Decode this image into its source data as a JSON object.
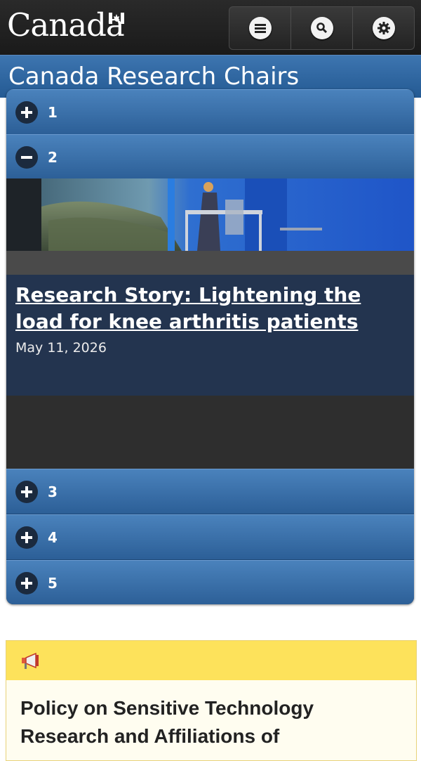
{
  "header": {
    "wordmark": "Canada",
    "buttons": [
      {
        "name": "menu",
        "icon": "menu-icon"
      },
      {
        "name": "search",
        "icon": "search-icon"
      },
      {
        "name": "settings",
        "icon": "gear-icon"
      }
    ]
  },
  "site_title": "Canada Research Chairs",
  "accordion": {
    "items": [
      {
        "label": "1",
        "state": "collapsed"
      },
      {
        "label": "2",
        "state": "expanded"
      },
      {
        "label": "3",
        "state": "collapsed"
      },
      {
        "label": "4",
        "state": "collapsed"
      },
      {
        "label": "5",
        "state": "collapsed"
      }
    ],
    "expanded_panel": {
      "story_title": "Research Story: Lightening the load for knee arthritis patients",
      "date": "May 11, 2026"
    }
  },
  "notice": {
    "icon": "megaphone-icon",
    "title": "Policy on Sensitive Technology Research and Affiliations of"
  },
  "colors": {
    "header_bg": "#1a1a1a",
    "accent_blue": "#2c5f97",
    "story_bg": "#23344f",
    "notice_yellow": "#fde25b"
  }
}
